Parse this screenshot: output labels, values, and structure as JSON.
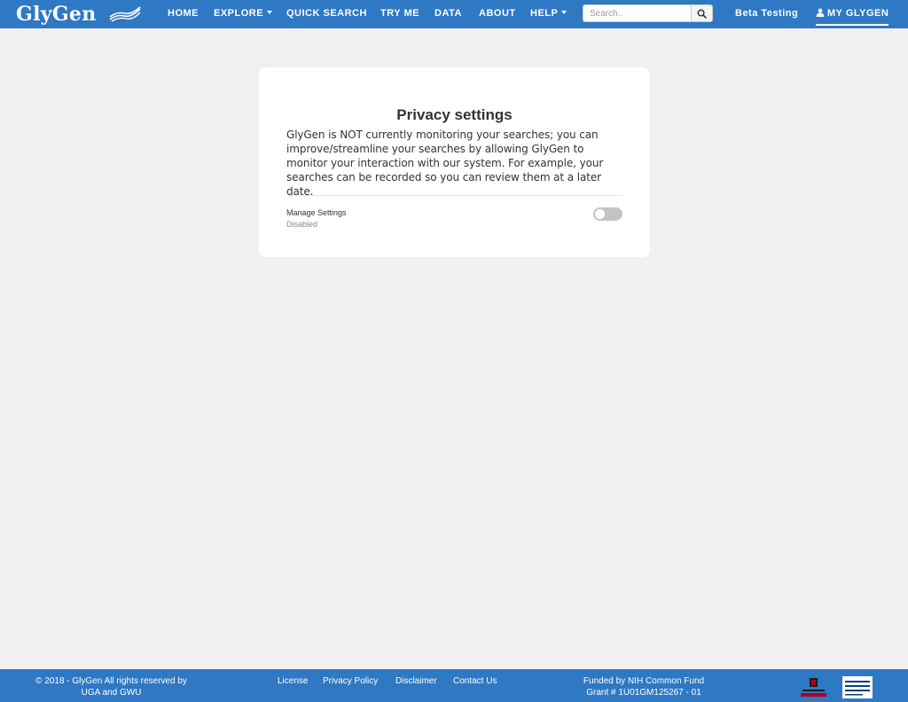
{
  "brand": {
    "name": "GlyGen"
  },
  "nav": {
    "items": [
      {
        "label": "HOME",
        "dropdown": false
      },
      {
        "label": "EXPLORE",
        "dropdown": true
      },
      {
        "label": "QUICK SEARCH",
        "dropdown": false
      },
      {
        "label": "TRY ME",
        "dropdown": false
      },
      {
        "label": "DATA",
        "dropdown": false
      },
      {
        "label": "ABOUT",
        "dropdown": false
      },
      {
        "label": "HELP",
        "dropdown": true
      }
    ],
    "search_placeholder": "Search..",
    "search_icon": "search-icon",
    "beta": "Beta Testing",
    "my_glygen": "MY GLYGEN",
    "user_icon": "user-icon"
  },
  "privacy": {
    "title": "Privacy settings",
    "description": "GlyGen is NOT currently monitoring your searches; you can improve/streamline your searches by allowing GlyGen to monitor your interaction with our system. For example, your searches can be recorded so you can review them at a later date.",
    "setting_label": "Manage Settings",
    "setting_status": "Disabled",
    "toggle_on": false
  },
  "footer": {
    "copyright": "© 2018 - GlyGen All rights reserved by UGA and GWU",
    "links": [
      "License",
      "Privacy Policy",
      "Disclaimer",
      "Contact Us"
    ],
    "funding_line1": "Funded by NIH Common Fund",
    "funding_line2": "Grant # 1U01GM125267 - 01",
    "logos": [
      "University of Georgia",
      "The George Washington University"
    ]
  },
  "colors": {
    "nav_bg": "#2f78c4",
    "page_bg": "#f0f0f0",
    "toggle_off": "#c3c3c3"
  }
}
